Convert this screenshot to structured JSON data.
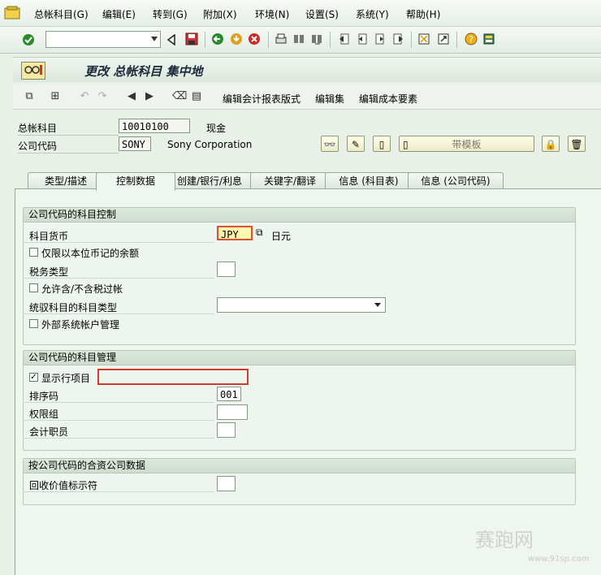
{
  "menu": {
    "items": [
      "总帐科目(G)",
      "编辑(E)",
      "转到(G)",
      "附加(X)",
      "环境(N)",
      "设置(S)",
      "系统(Y)",
      "帮助(H)"
    ]
  },
  "toolbar": {
    "command_field_value": "",
    "icons": [
      "enter-icon",
      "back-icon",
      "save-icon",
      "back-green-icon",
      "exit-icon",
      "cancel-icon",
      "print-icon",
      "find-icon",
      "find-next-icon",
      "first-page-icon",
      "prev-page-icon",
      "next-page-icon",
      "last-page-icon",
      "new-session-icon",
      "shortcut-icon",
      "help-icon",
      "layout-icon"
    ]
  },
  "title": "更改 总帐科目 集中地",
  "app_toolbar": {
    "edit_report_layout": "编辑会计报表版式",
    "edit_set": "编辑集",
    "edit_cost_element": "编辑成本要素"
  },
  "header": {
    "gl_account_label": "总帐科目",
    "gl_account_value": "10010100",
    "gl_account_desc": "现金",
    "company_code_label": "公司代码",
    "company_code_value": "SONY",
    "company_code_desc": "Sony Corporation",
    "template_button": "带模板"
  },
  "tabs": [
    {
      "label": "类型/描述",
      "active": false
    },
    {
      "label": "控制数据",
      "active": true
    },
    {
      "label": "创建/银行/利息",
      "active": false
    },
    {
      "label": "关键字/翻译",
      "active": false
    },
    {
      "label": "信息 (科目表)",
      "active": false
    },
    {
      "label": "信息 (公司代码)",
      "active": false
    }
  ],
  "control_group": {
    "title": "公司代码的科目控制",
    "currency_label": "科目货币",
    "currency_value": "JPY",
    "currency_desc": "日元",
    "local_currency_only_label": "仅限以本位币记的余额",
    "local_currency_only_checked": false,
    "tax_category_label": "税务类型",
    "tax_category_value": "",
    "posting_without_tax_label": "允许含/不含税过帐",
    "posting_without_tax_checked": false,
    "recon_account_label": "统驭科目的科目类型",
    "recon_account_value": "",
    "external_mgmt_label": "外部系统帐户管理",
    "external_mgmt_checked": false
  },
  "mgmt_group": {
    "title": "公司代码的科目管理",
    "line_items_label": "显示行项目",
    "line_items_checked": true,
    "sort_key_label": "排序码",
    "sort_key_value": "001",
    "auth_group_label": "权限组",
    "auth_group_value": "",
    "clerk_label": "会计职员",
    "clerk_value": ""
  },
  "jv_group": {
    "title": "按公司代码的合资公司数据",
    "recovery_indicator_label": "回收价值标示符",
    "recovery_indicator_value": ""
  },
  "watermark": {
    "text": "赛跑网",
    "url": "www.91sp.com"
  }
}
